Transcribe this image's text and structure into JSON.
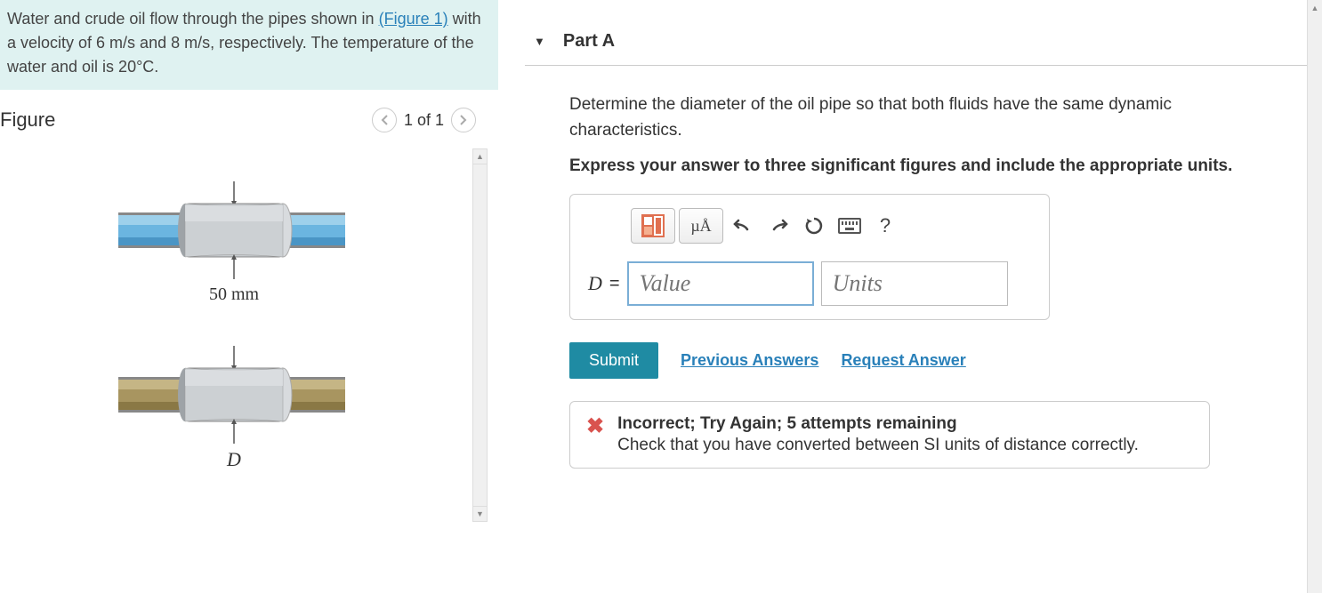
{
  "problem": {
    "text_1": "Water and crude oil flow through the pipes shown in ",
    "figure_link": "(Figure 1)",
    "text_2": " with a velocity of 6 m/s and 8 m/s, respectively. The temperature of the water and oil is 20°C."
  },
  "figure": {
    "title": "Figure",
    "nav_label": "1 of 1",
    "pipe1_label": "50 mm",
    "pipe2_label": "D"
  },
  "part": {
    "title": "Part A",
    "question": "Determine the diameter of the oil pipe so that both fluids have the same dynamic characteristics.",
    "instruction": "Express your answer to three significant figures and include the appropriate units."
  },
  "input": {
    "label": "D",
    "equals": "=",
    "value_placeholder": "Value",
    "units_placeholder": "Units",
    "mu_a": "µÅ",
    "help": "?"
  },
  "actions": {
    "submit": "Submit",
    "previous": "Previous Answers",
    "request": "Request Answer"
  },
  "feedback": {
    "title": "Incorrect; Try Again; 5 attempts remaining",
    "message": "Check that you have converted between SI units of distance correctly."
  }
}
